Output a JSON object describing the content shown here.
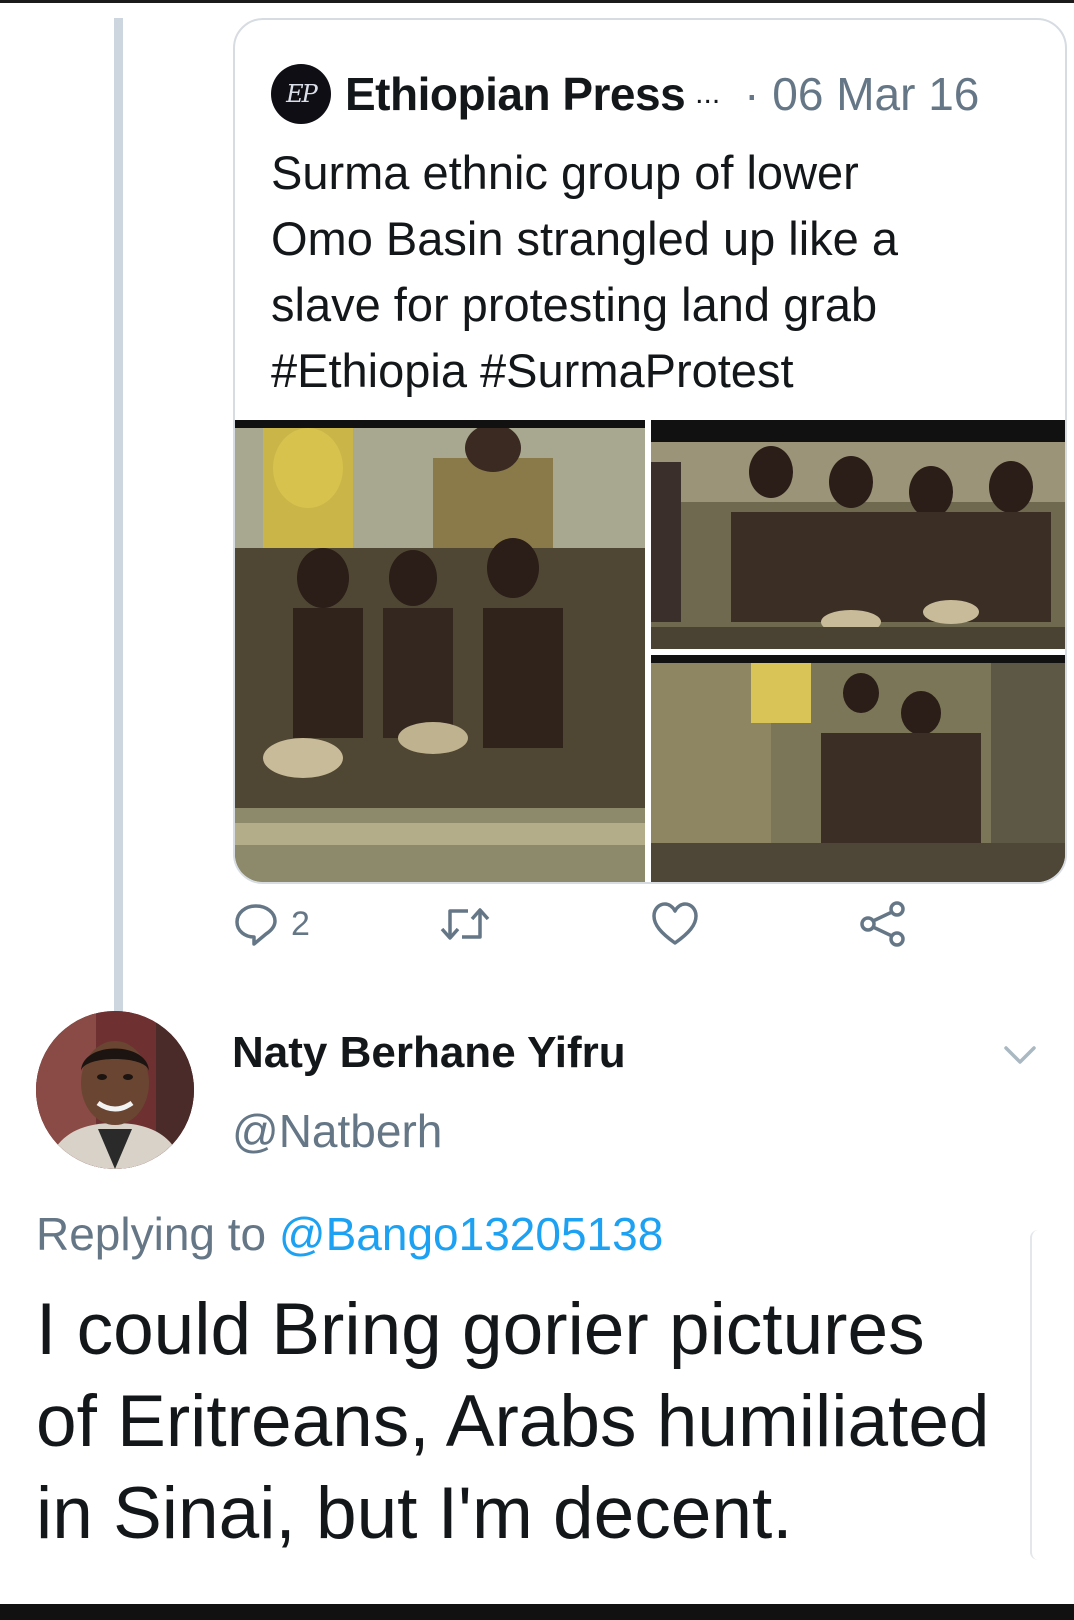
{
  "quoted_tweet": {
    "avatar_text": "EP",
    "name": "Ethiopian Press",
    "name_ellipsis": "...",
    "date": "· 06 Mar 16",
    "text": "Surma ethnic group of lower\nOmo Basin strangled up like a\nslave for protesting land grab\n#Ethiopia #SurmaProtest"
  },
  "actions": {
    "reply_count": "2",
    "icons": [
      "reply-icon",
      "retweet-icon",
      "like-icon",
      "share-icon"
    ]
  },
  "reply_tweet": {
    "name": "Naty Berhane Yifru",
    "handle": "@Natberh",
    "replying_prefix": "Replying to",
    "replying_handle": "@Bango13205138",
    "text": "I could Bring gorier pictures\nof Eritreans, Arabs humiliated\nin Sinai, but I'm decent."
  },
  "colors": {
    "text": "#14171a",
    "secondary": "#657786",
    "link": "#1da1f2",
    "border": "#d6dce2",
    "thread_line": "#cdd6df"
  }
}
